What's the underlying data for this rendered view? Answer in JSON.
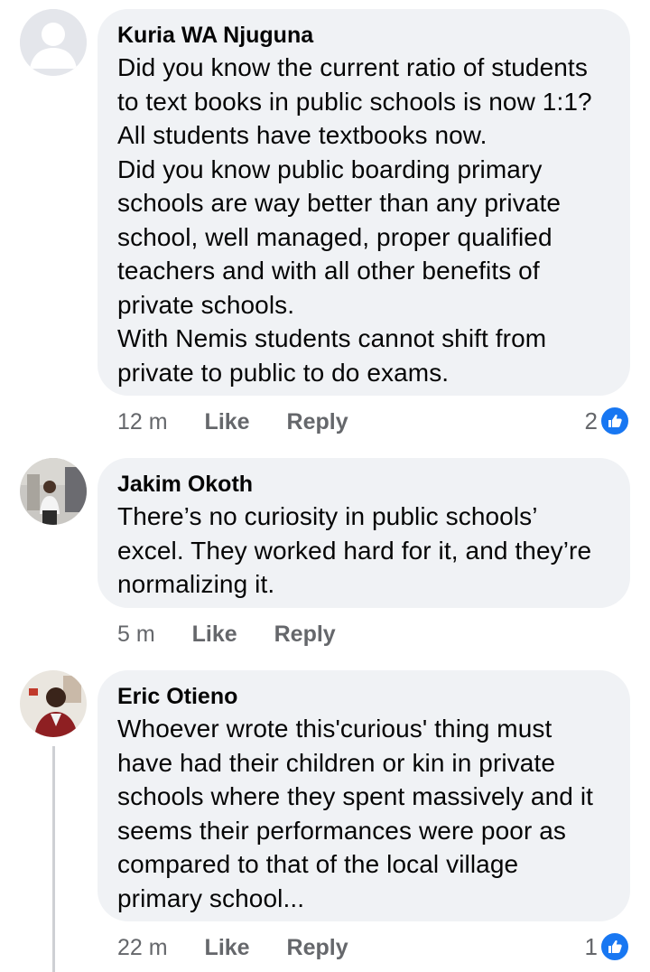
{
  "comments": [
    {
      "author": "Kuria WA Njuguna",
      "text": "Did you know the current ratio of students to text books in public schools is now 1:1? All students have textbooks now.\nDid you know public boarding primary schools are way better than any private school, well managed, proper qualified teachers and with all other benefits of private schools.\nWith Nemis students cannot shift from private to public to do exams.",
      "time": "12 m",
      "like_label": "Like",
      "reply_label": "Reply",
      "reaction_count": "2",
      "avatar_icon": "default-profile-icon"
    },
    {
      "author": "Jakim Okoth",
      "text": "There’s no curiosity in public schools’ excel. They worked hard for it, and they’re normalizing it.",
      "time": "5 m",
      "like_label": "Like",
      "reply_label": "Reply",
      "avatar_icon": "profile-photo"
    },
    {
      "author": "Eric Otieno",
      "text": "Whoever wrote this'curious' thing must have had their children or kin in private schools where they spent massively and it seems their performances were poor as compared to that of the local village primary school...",
      "time": "22 m",
      "like_label": "Like",
      "reply_label": "Reply",
      "reaction_count": "1",
      "avatar_icon": "profile-photo"
    }
  ],
  "colors": {
    "bubble": "#f0f2f5",
    "meta_text": "#65676b",
    "like_blue": "#1877f2"
  }
}
